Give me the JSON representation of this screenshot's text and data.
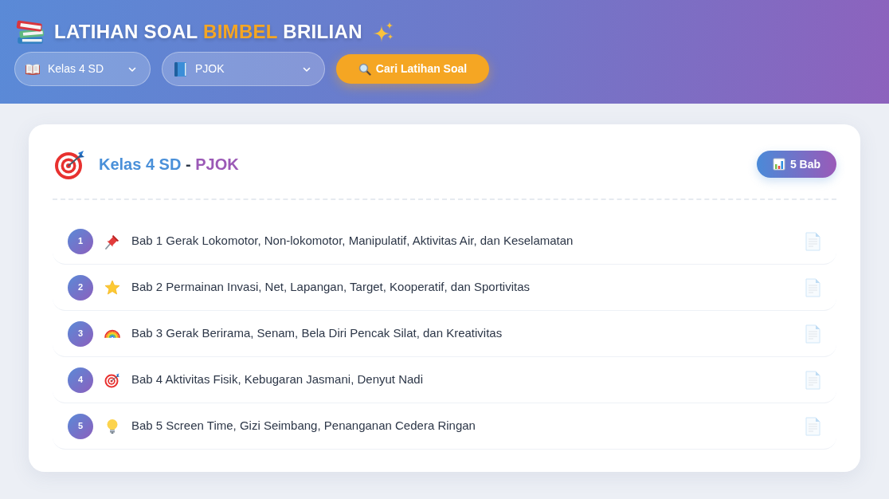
{
  "header": {
    "title_parts": [
      {
        "text": "LATIHAN SOAL ",
        "highlight": false
      },
      {
        "text": "BIMBEL",
        "highlight": true
      },
      {
        "text": " BRILIAN",
        "highlight": false
      }
    ],
    "filters": [
      {
        "value": "Kelas 4 SD"
      },
      {
        "value": "PJOK"
      }
    ],
    "search_button": {
      "label": "Cari Latihan Soal"
    }
  },
  "card": {
    "heading": {
      "grade": "Kelas 4 SD",
      "separator": "-",
      "subject": "PJOK"
    },
    "chapter_count": "5 Bab",
    "chapters": [
      {
        "number": "1",
        "title": "Bab 1 Gerak Lokomotor, Non-lokomotor, Manipulatif, Aktivitas Air, dan Keselamatan"
      },
      {
        "number": "2",
        "title": "Bab 2 Permainan Invasi, Net, Lapangan, Target, Kooperatif, dan Sportivitas"
      },
      {
        "number": "3",
        "title": "Bab 3 Gerak Berirama, Senam, Bela Diri Pencak Silat, dan Kreativitas"
      },
      {
        "number": "4",
        "title": "Bab 4 Aktivitas Fisik, Kebugaran Jasmani, Denyut Nadi"
      },
      {
        "number": "5",
        "title": "Bab 5 Screen Time, Gizi Seimbang, Penanganan Cedera Ringan"
      }
    ]
  }
}
